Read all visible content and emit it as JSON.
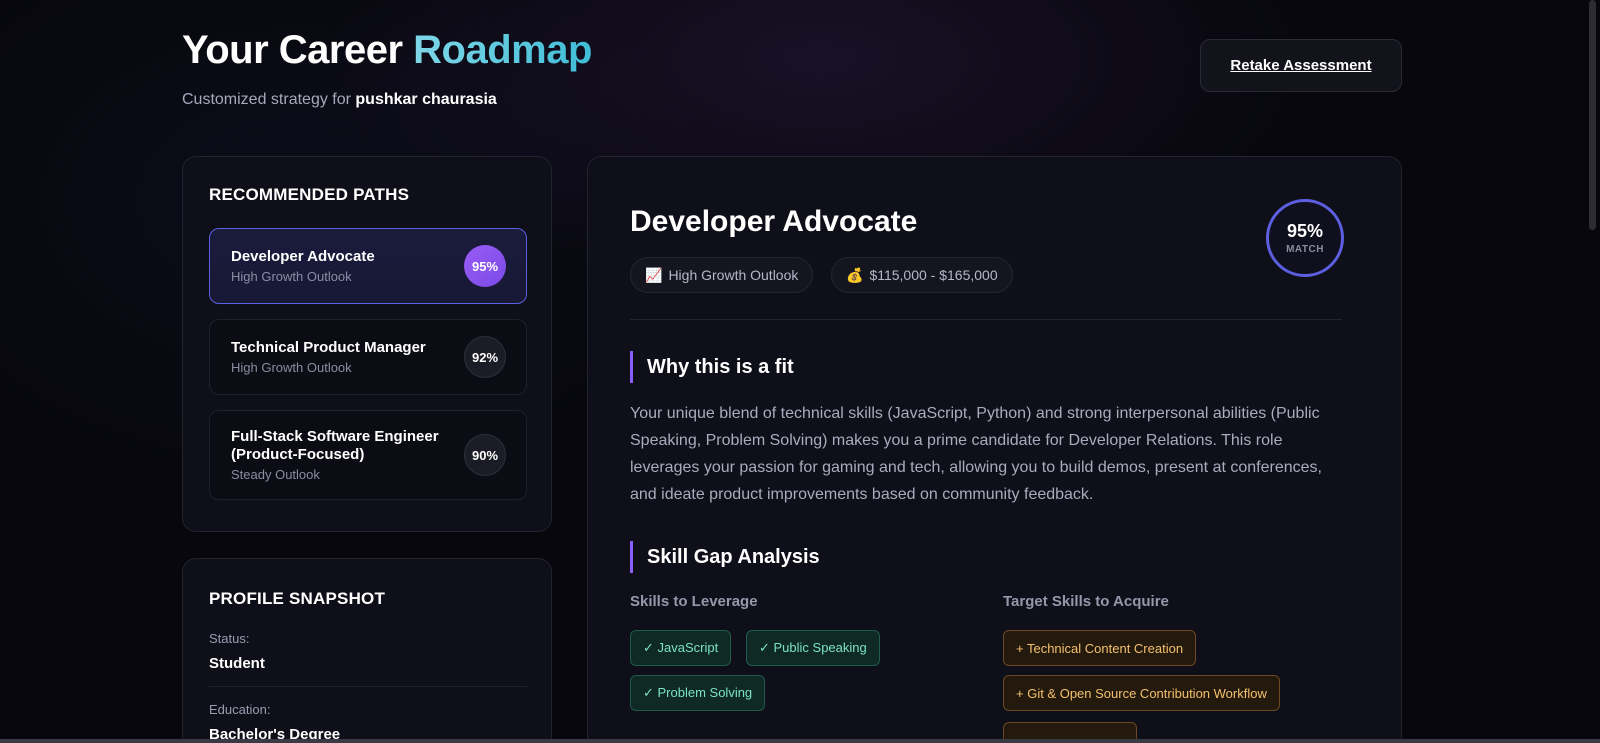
{
  "header": {
    "title_main": "Your Career ",
    "title_accent": "Roadmap",
    "subtitle_prefix": "Customized strategy for ",
    "user_name": "pushkar chaurasia",
    "retake_label": "Retake Assessment"
  },
  "recommended": {
    "heading": "RECOMMENDED PATHS",
    "items": [
      {
        "name": "Developer Advocate",
        "outlook": "High Growth Outlook",
        "match": "95%"
      },
      {
        "name": "Technical Product Manager",
        "outlook": "High Growth Outlook",
        "match": "92%"
      },
      {
        "name": "Full-Stack Software Engineer (Product-Focused)",
        "outlook": "Steady Outlook",
        "match": "90%"
      }
    ]
  },
  "snapshot": {
    "heading": "PROFILE SNAPSHOT",
    "rows": [
      {
        "label": "Status:",
        "value": "Student"
      },
      {
        "label": "Education:",
        "value": "Bachelor's Degree"
      }
    ]
  },
  "detail": {
    "title": "Developer Advocate",
    "chips": [
      {
        "icon": "📈",
        "icon_name": "chart-up-icon",
        "text": "High Growth Outlook"
      },
      {
        "icon": "💰",
        "icon_name": "money-bag-icon",
        "text": "$115,000 - $165,000"
      }
    ],
    "match_value": "95%",
    "match_label": "MATCH",
    "fit_heading": "Why this is a fit",
    "fit_text": "Your unique blend of technical skills (JavaScript, Python) and strong interpersonal abilities (Public Speaking, Problem Solving) makes you a prime candidate for Developer Relations. This role leverages your passion for gaming and tech, allowing you to build demos, present at conferences, and ideate product improvements based on community feedback.",
    "gap_heading": "Skill Gap Analysis",
    "leverage_heading": "Skills to Leverage",
    "leverage_skills": [
      "✓ JavaScript",
      "✓ Public Speaking",
      "✓ Problem Solving"
    ],
    "acquire_heading": "Target Skills to Acquire",
    "acquire_skills": [
      "+ Technical Content Creation",
      "+ Git & Open Source Contribution Workflow"
    ]
  },
  "colors": {
    "accent_purple": "#8b5cf6",
    "accent_indigo": "#5b5fe0",
    "accent_cyan": "#3fbdd6",
    "skill_have": "#7be3bf",
    "skill_want": "#f3c06d"
  }
}
